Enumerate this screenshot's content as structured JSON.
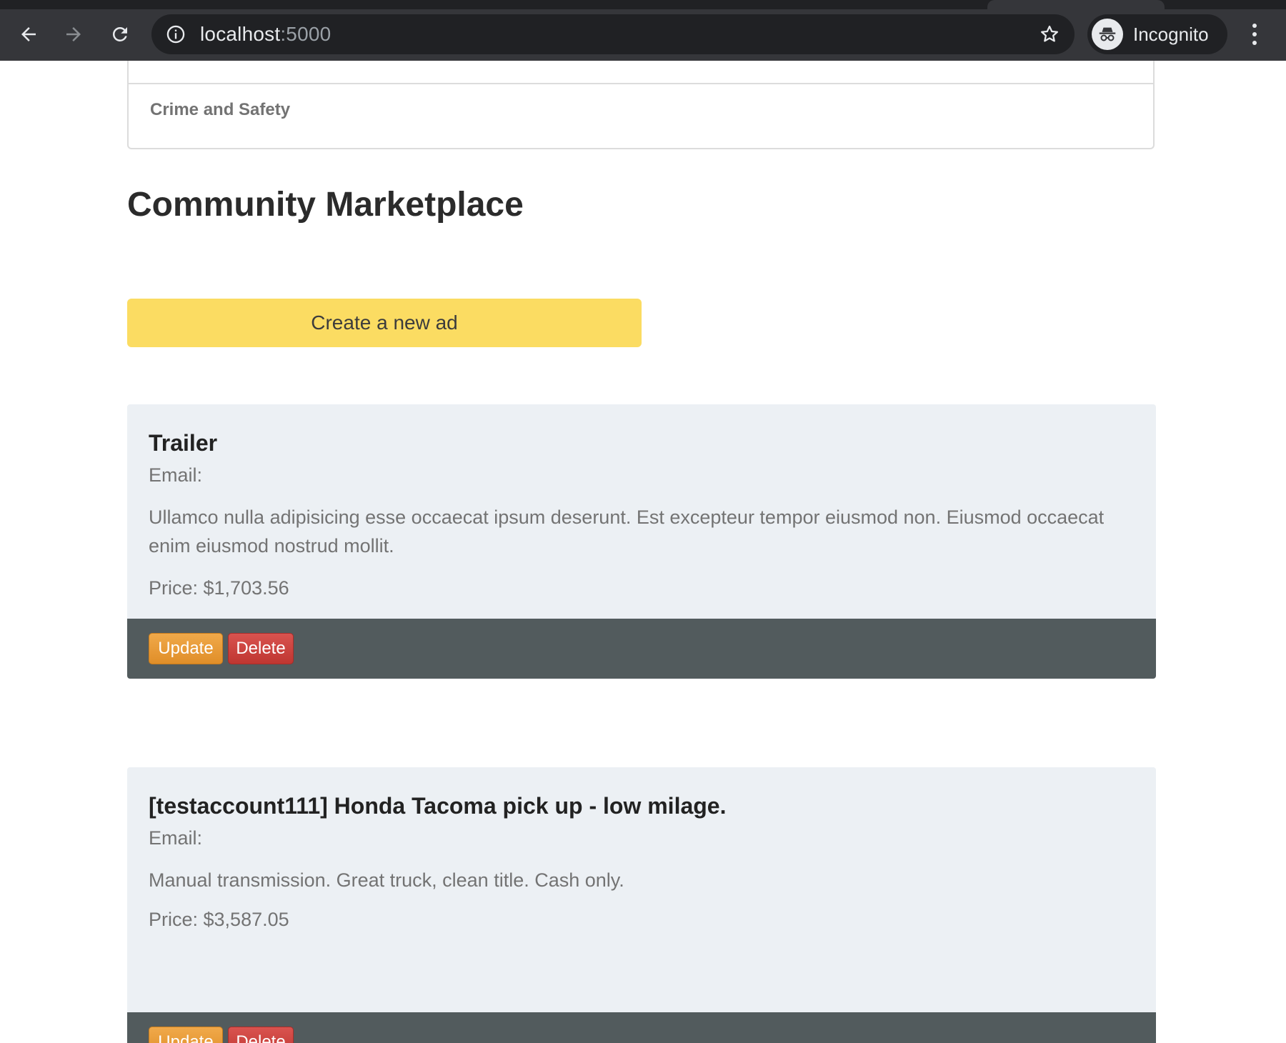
{
  "browser": {
    "url_host": "localhost",
    "url_port": ":5000",
    "profile_label": "Incognito",
    "icons": [
      "back-arrow-icon",
      "forward-arrow-icon",
      "reload-icon",
      "info-icon",
      "star-icon",
      "incognito-icon",
      "kebab-menu-icon"
    ]
  },
  "nav_card": {
    "item": "Crime and Safety"
  },
  "page": {
    "title": "Community Marketplace",
    "create_button": "Create a new ad"
  },
  "ads": [
    {
      "title": "Trailer",
      "email_label": "Email:",
      "description": "Ullamco nulla adipisicing esse occaecat ipsum deserunt. Est excepteur tempor eiusmod non. Eiusmod occaecat enim eiusmod nostrud mollit.",
      "price": "Price: $1,703.56",
      "update_label": "Update",
      "delete_label": "Delete"
    },
    {
      "title": "[testaccount111] Honda Tacoma pick up - low milage.",
      "email_label": "Email:",
      "description": "Manual transmission. Great truck, clean title. Cash only.",
      "price": "Price: $3,587.05",
      "update_label": "Update",
      "delete_label": "Delete"
    }
  ],
  "colors": {
    "accent_button": "#fbdc62",
    "card_background": "#ecf0f4",
    "card_footer": "#525b5d",
    "update_button": "#e8992f",
    "delete_button": "#cc4440"
  }
}
